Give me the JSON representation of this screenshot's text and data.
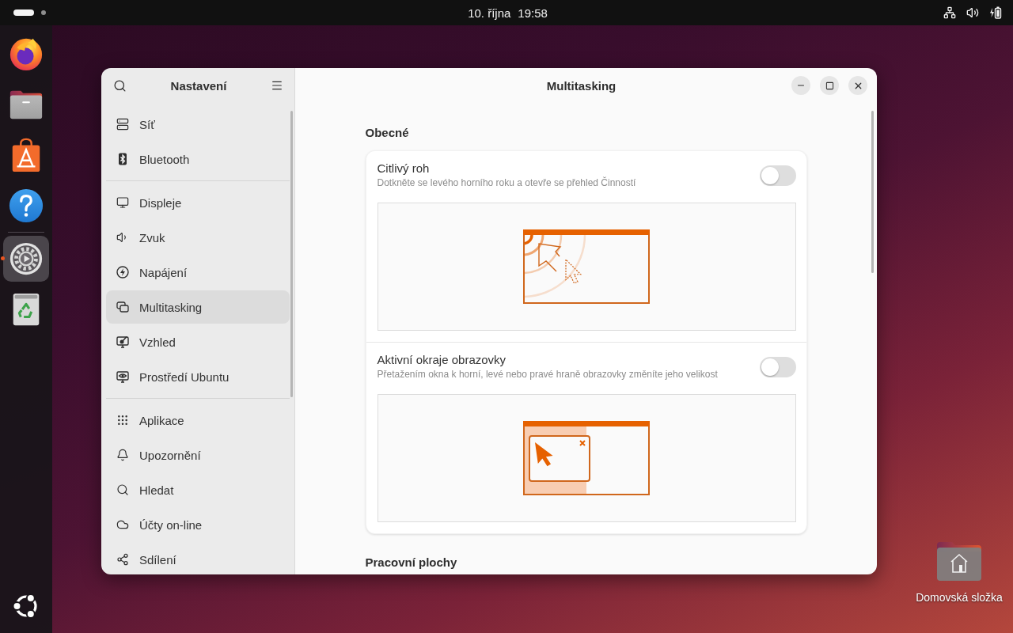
{
  "top_bar": {
    "workspaces": [
      {
        "selected": true
      },
      {
        "selected": false
      }
    ],
    "clock": {
      "date": "10. října",
      "time": "19:58"
    }
  },
  "dock": {
    "favorites": [
      {
        "kind": "browser",
        "running": false,
        "focused": false
      },
      {
        "kind": "files",
        "running": false,
        "focused": false
      },
      {
        "kind": "app-center",
        "running": false,
        "focused": false
      },
      {
        "kind": "help",
        "running": false,
        "focused": false
      }
    ],
    "others": [
      {
        "kind": "settings",
        "running": true,
        "focused": true
      },
      {
        "kind": "trash",
        "running": false,
        "focused": false
      }
    ]
  },
  "settings_window": {
    "sidebar": {
      "title": "Nastavení",
      "groups": [
        {
          "items": [
            {
              "label": "Síť",
              "kind": "network",
              "selected": false
            },
            {
              "label": "Bluetooth",
              "kind": "bluetooth",
              "selected": false
            }
          ]
        },
        {
          "items": [
            {
              "label": "Displeje",
              "kind": "displays",
              "selected": false
            },
            {
              "label": "Zvuk",
              "kind": "sound",
              "selected": false
            },
            {
              "label": "Napájení",
              "kind": "power",
              "selected": false
            },
            {
              "label": "Multitasking",
              "kind": "multitasking",
              "selected": true
            },
            {
              "label": "Vzhled",
              "kind": "appearance",
              "selected": false
            },
            {
              "label": "Prostředí Ubuntu",
              "kind": "ubuntu-desktop",
              "selected": false
            }
          ]
        },
        {
          "items": [
            {
              "label": "Aplikace",
              "kind": "apps",
              "selected": false
            },
            {
              "label": "Upozornění",
              "kind": "notifications",
              "selected": false
            },
            {
              "label": "Hledat",
              "kind": "search",
              "selected": false
            },
            {
              "label": "Účty on-line",
              "kind": "online-accounts",
              "selected": false
            },
            {
              "label": "Sdílení",
              "kind": "sharing",
              "selected": false
            }
          ]
        }
      ]
    },
    "page": {
      "title": "Multitasking",
      "sections": [
        {
          "heading": "Obecné",
          "rows": [
            {
              "kind": "hot-corner",
              "title": "Citlivý roh",
              "subtitle": "Dotkněte se levého horního roku a otevře se přehled Činností",
              "on": false
            },
            {
              "kind": "active-edges",
              "title": "Aktivní okraje obrazovky",
              "subtitle": "Přetažením okna k horní, levé nebo pravé hraně obrazovky změníte jeho velikost",
              "on": false
            }
          ]
        },
        {
          "heading": "Pracovní plochy"
        }
      ]
    }
  },
  "desktop_icons": [
    {
      "kind": "home",
      "label": "Domovská složka"
    }
  ]
}
